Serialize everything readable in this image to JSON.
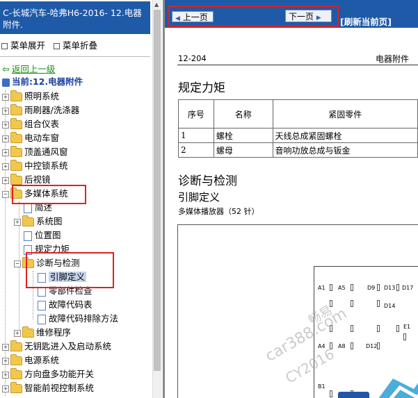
{
  "tree": {
    "title": "C-长城汽车-哈弗H6-2016- 12.电器附件.",
    "menu_expand": "菜单展开",
    "menu_collapse": "菜单折叠",
    "back": "返回上一级",
    "current": "当前:12.电器附件",
    "items": [
      {
        "label": "照明系统"
      },
      {
        "label": "雨刷器/洗涤器"
      },
      {
        "label": "组合仪表"
      },
      {
        "label": "电动车窗"
      },
      {
        "label": "顶盖通风窗"
      },
      {
        "label": "中控锁系统"
      },
      {
        "label": "后视镜"
      },
      {
        "label": "多媒体系统"
      },
      {
        "label": "简述"
      },
      {
        "label": "系统图"
      },
      {
        "label": "位置图"
      },
      {
        "label": "规定力矩"
      },
      {
        "label": "诊断与检测"
      },
      {
        "label": "引脚定义"
      },
      {
        "label": "零部件检查"
      },
      {
        "label": "故障代码表"
      },
      {
        "label": "故障代码排除方法"
      },
      {
        "label": "维修程序"
      },
      {
        "label": "无钥匙进入及启动系统"
      },
      {
        "label": "电源系统"
      },
      {
        "label": "方向盘多功能开关"
      },
      {
        "label": "智能前视控制系统"
      }
    ]
  },
  "nav": {
    "prev": "上一页",
    "next": "下一页",
    "refresh": "[刷新当前页]"
  },
  "doc": {
    "page_no": "12-204",
    "section": "电器附件",
    "torque_title": "规定力矩",
    "table": {
      "headers": [
        "序号",
        "名称",
        "紧固零件"
      ],
      "rows": [
        [
          "1",
          "螺栓",
          "天线总成紧固螺栓"
        ],
        [
          "2",
          "螺母",
          "音响功放总成与钣金"
        ]
      ]
    },
    "diag_title": "诊断与检测",
    "pin_title": "引脚定义",
    "pin_subtitle": "多媒体播放器（52 针）",
    "pins": [
      "A1",
      "A5",
      "D9",
      "D13",
      "D17",
      "D14",
      "E1",
      "A4",
      "A8",
      "D12",
      "B1"
    ],
    "watermark": [
      "畅易",
      "car388.com",
      "CY2016"
    ]
  },
  "colors": {
    "title_bar": "#1f5aa8",
    "annotation_red": "#e02020",
    "back_link": "#1a8a1a"
  }
}
